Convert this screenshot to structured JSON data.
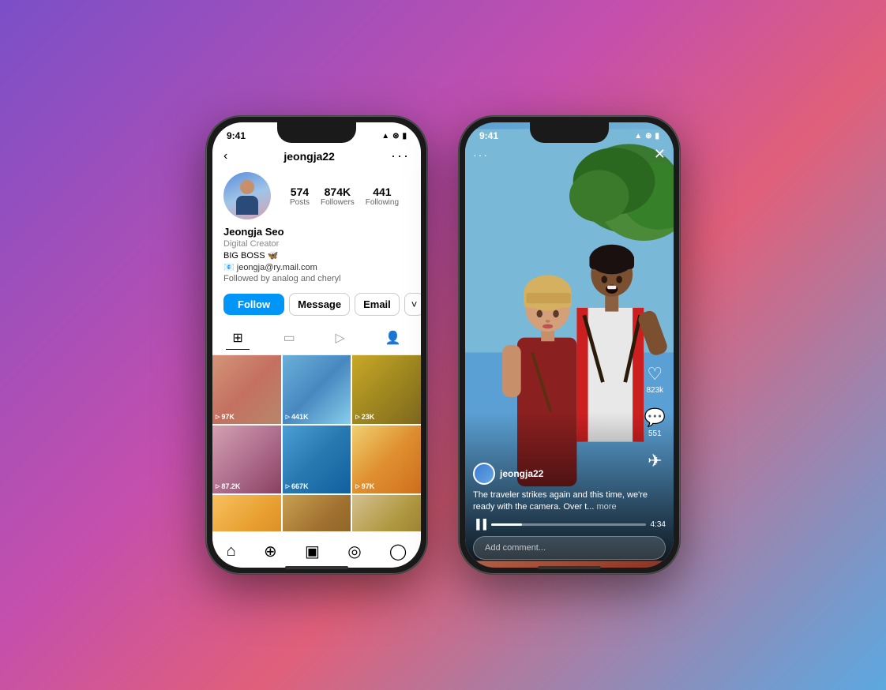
{
  "background": {
    "gradient": "linear-gradient(135deg, #7b4fc8, #c44fad, #e05f7a, #5ca8e0)"
  },
  "phone1": {
    "statusBar": {
      "time": "9:41",
      "icons": "▲ WiFi Batt"
    },
    "nav": {
      "back": "‹",
      "title": "jeongja22",
      "more": "···"
    },
    "profile": {
      "name": "Jeongja Seo",
      "role": "Digital Creator",
      "bio": "BIG BOSS 🦋",
      "email": "📧 jeongja@ry.mail.com",
      "followedBy": "Followed by analog and cheryl"
    },
    "stats": [
      {
        "value": "574",
        "label": "Posts"
      },
      {
        "value": "874K",
        "label": "Followers"
      },
      {
        "value": "441",
        "label": "Following"
      }
    ],
    "buttons": {
      "follow": "Follow",
      "message": "Message",
      "email": "Email",
      "more": "˅"
    },
    "grid": [
      {
        "views": "▷ 97K",
        "color": "g1"
      },
      {
        "views": "▷ 441K",
        "color": "g2"
      },
      {
        "views": "▷ 23K",
        "color": "g3"
      },
      {
        "views": "▷ 87.2K",
        "color": "g4"
      },
      {
        "views": "▷ 667K",
        "color": "g5"
      },
      {
        "views": "▷ 97K",
        "color": "g6"
      },
      {
        "views": "",
        "color": "g7"
      },
      {
        "views": "",
        "color": "g8"
      },
      {
        "views": "",
        "color": "g9"
      }
    ],
    "bottomNav": [
      "🏠",
      "🔍",
      "🎬",
      "🛍",
      "👤"
    ]
  },
  "phone2": {
    "statusBar": {
      "time": "9:41",
      "icons": "▲ WiFi Batt"
    },
    "topControls": {
      "dots": "···",
      "close": "✕"
    },
    "actions": [
      {
        "icon": "♡",
        "count": "823k",
        "name": "like"
      },
      {
        "icon": "💬",
        "count": "551",
        "name": "comment"
      },
      {
        "icon": "✈",
        "count": "",
        "name": "share"
      }
    ],
    "user": {
      "username": "jeongja22"
    },
    "caption": "The traveler strikes again and this time, we're ready with the camera. Over t...",
    "captionMore": "more",
    "progress": {
      "played": "▐▐",
      "time": "4:34"
    },
    "commentPlaceholder": "Add comment..."
  }
}
